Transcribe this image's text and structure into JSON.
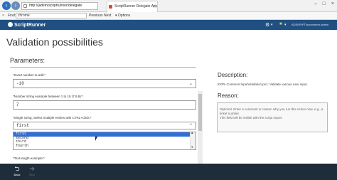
{
  "browser": {
    "address": "http://jadsm/scriptrunner/delegate",
    "tab_title": "ScriptRunner Delegate App",
    "find": {
      "label": "Find:",
      "value": "chrome",
      "prev": "Previous",
      "next": "Next",
      "options": "Options"
    }
  },
  "header": {
    "logo_text": "ScriptRunner",
    "user": "ADSKRIPT\\scrunnerto-admin"
  },
  "page": {
    "title": "Validation possibilities",
    "parameters_title": "Parameters:",
    "fields": [
      {
        "label": "*Invert number to add:*",
        "value": "-10"
      },
      {
        "label": "*Number string example between 1 to 18 (7.8,9):*",
        "value": "7"
      },
      {
        "label": "*Single string; Select multiple entries with CTRL+Click:*",
        "value": "first"
      },
      {
        "label": "*Text length example:*"
      }
    ],
    "list_options": [
      "first",
      "second",
      "third",
      "fourth"
    ],
    "list_selected": "first"
  },
  "right": {
    "description_title": "Description:",
    "description_text": "EXPL-Common:InputValidation.ps1: Validate various user input.",
    "reason_title": "Reason:",
    "reason_lines": [
      "Optional. Enter a comment or reason why you run this Action now, e.g., a",
      "ticket number.",
      "This field will be visible with the script report."
    ]
  },
  "toolbar": {
    "back": "Back",
    "run": "Run"
  },
  "icons": {
    "back": "back-arrow-icon",
    "run": "run-icon",
    "settings": "gear-icon",
    "flag": "flag-icon"
  },
  "colors": {
    "header": "#205081",
    "accent": "#e6a17f",
    "selection": "#2f6ed6",
    "toolbar": "#1f2c3a"
  }
}
